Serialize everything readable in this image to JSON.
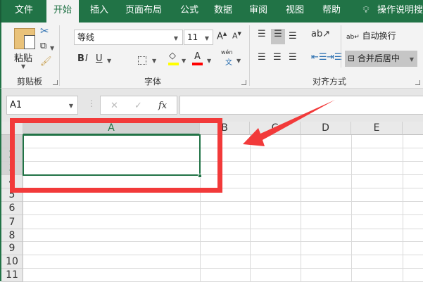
{
  "tabs": [
    "文件",
    "开始",
    "插入",
    "页面布局",
    "公式",
    "数据",
    "审阅",
    "视图",
    "帮助"
  ],
  "active_tab": "开始",
  "tell_me": "操作说明搜索",
  "clipboard": {
    "paste": "粘贴",
    "group": "剪贴板"
  },
  "font": {
    "name": "等线",
    "size": "11",
    "group": "字体",
    "bold": "B",
    "italic": "I",
    "underline": "U",
    "phonetic": "wén"
  },
  "alignment": {
    "wrap": "自动换行",
    "merge": "合并后居中",
    "group": "对齐方式"
  },
  "formula_bar": {
    "name_box": "A1",
    "fx": "fx",
    "formula": ""
  },
  "columns": [
    "A",
    "B",
    "C",
    "D",
    "E"
  ],
  "rows": [
    "1",
    "2",
    "3",
    "4",
    "5",
    "6",
    "7",
    "8",
    "9",
    "10",
    "11"
  ],
  "selection": "A1:A3",
  "colors": {
    "accent": "#217346",
    "annotation": "#f23a3a",
    "highlight": "#ffff00",
    "font_color": "#ff0000"
  }
}
